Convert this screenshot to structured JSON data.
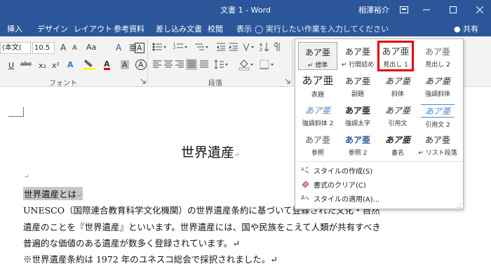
{
  "window": {
    "title": "文書 1 - Word",
    "user": "相澤裕介",
    "ribbon_options_icon": "ribbon-display-icon",
    "minimize_icon": "minimize-icon",
    "maximize_icon": "maximize-icon",
    "close_icon": "close-icon"
  },
  "tabs": [
    "挿入",
    "デザイン",
    "レイアウト",
    "参考資料",
    "差し込み文書",
    "校閲",
    "表示"
  ],
  "tell_me": {
    "icon": "lightbulb-icon",
    "text": "実行したい作業を入力してください"
  },
  "share": {
    "icon": "person-icon",
    "label": "共有"
  },
  "ribbon": {
    "font_name": "(本文(",
    "font_size": "10.5",
    "grow_font_label": "A",
    "shrink_font_label": "A",
    "aa_label": "Aa",
    "clear_format_label": "A",
    "underline_label": "U",
    "strike_label": "abc",
    "subscript_label": "x₂",
    "superscript_label": "x²",
    "text_effect_label": "A",
    "font_color_label": "A",
    "char_shade_label": "A",
    "char_border_label": "A",
    "phonetic_label": "亜",
    "font_group_label": "フォント",
    "paragraph_group_label": "段落",
    "colors": {
      "font_color": "#e00000",
      "highlight": "#ffff00"
    }
  },
  "gallery": {
    "styles": [
      {
        "preview": "あア亜",
        "name": "↵ 標準"
      },
      {
        "preview": "あア亜",
        "name": "↵ 行間詰め"
      },
      {
        "preview": "あア亜",
        "name": "見出し 1"
      },
      {
        "preview": "あア亜",
        "name": "見出し 2"
      },
      {
        "preview": "あア亜",
        "name": "表題"
      },
      {
        "preview": "あア亜",
        "name": "副題"
      },
      {
        "preview": "あア亜",
        "name": "斜体"
      },
      {
        "preview": "あア亜",
        "name": "強調斜体"
      },
      {
        "preview": "あア亜",
        "name": "強調斜体 2"
      },
      {
        "preview": "あア亜",
        "name": "強調太字"
      },
      {
        "preview": "あア亜",
        "name": "引用文"
      },
      {
        "preview": "あア亜",
        "name": "引用文 2"
      },
      {
        "preview": "あア亜",
        "name": "参照"
      },
      {
        "preview": "あア亜",
        "name": "参照 2"
      },
      {
        "preview": "あア亜",
        "name": "書名"
      },
      {
        "preview": "あア亜",
        "name": "↵ リスト段落"
      }
    ],
    "menu": [
      {
        "icon": "create-style-icon",
        "label": "スタイルの作成(S)"
      },
      {
        "icon": "eraser-icon",
        "label": "書式のクリア(C)"
      },
      {
        "icon": "apply-style-icon",
        "label": "スタイルの適用(A)..."
      }
    ],
    "highlight_color": "#e10000"
  },
  "document": {
    "title": "世界遺産",
    "heading": "世界遺産とは",
    "lines": [
      "UNESCO（国際連合教育科学文化機関）の世界遺産条約に基づいて登録された文化・自然",
      "遺産のことを『世界遺産』といいます。世界遺産には、国や民族をこえて人類が共有すべき",
      "普遍的な価値のある遺産が数多く登録されています。↵",
      "※世界遺産条約は 1972 年のユネスコ総会で採択されました。↵"
    ],
    "para_mark": "↵"
  }
}
